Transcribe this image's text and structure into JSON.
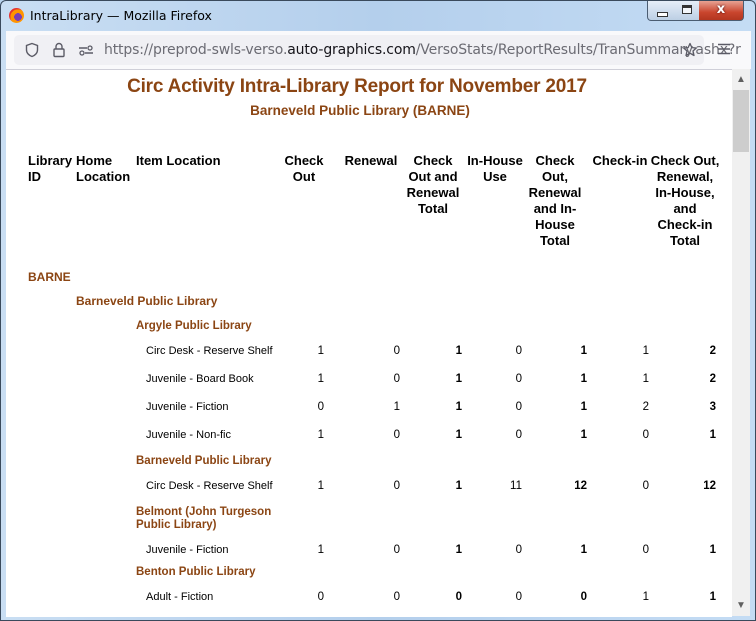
{
  "window": {
    "title": "IntraLibrary — Mozilla Firefox",
    "controls": {
      "minimize": "minimize",
      "maximize": "maximize",
      "close": "x"
    }
  },
  "browser": {
    "url_prefix": "https://preprod-swls-verso.",
    "url_domain": "auto-graphics.com",
    "url_path": "/VersoStats/ReportResults/TranSummary.ashx?r",
    "icons": [
      "shield-icon",
      "lock-icon",
      "permissions-icon",
      "bookmark-star-icon",
      "menu-icon"
    ]
  },
  "report": {
    "title": "Circ Activity Intra-Library Report for November 2017",
    "subtitle": "Barneveld Public Library (BARNE)",
    "columns": [
      "Library ID",
      "Home Location",
      "Item Location",
      "Check Out",
      "Renewal",
      "Check Out and Renewal Total",
      "In-House Use",
      "Check Out, Renewal and In-House Total",
      "Check-in",
      "Check Out, Renewal, In-House, and Check-in Total"
    ],
    "library_id": "BARNE",
    "home_location": "Barneveld Public Library",
    "groups": [
      {
        "name": "Argyle Public Library",
        "rows": [
          {
            "item": "Circ Desk - Reserve Shelf",
            "values": [
              "1",
              "0",
              "1",
              "0",
              "1",
              "1",
              "2"
            ]
          },
          {
            "item": "Juvenile - Board Book",
            "values": [
              "1",
              "0",
              "1",
              "0",
              "1",
              "1",
              "2"
            ]
          },
          {
            "item": "Juvenile - Fiction",
            "values": [
              "0",
              "1",
              "1",
              "0",
              "1",
              "2",
              "3"
            ]
          },
          {
            "item": "Juvenile - Non-fic",
            "values": [
              "1",
              "0",
              "1",
              "0",
              "1",
              "0",
              "1"
            ]
          }
        ]
      },
      {
        "name": "Barneveld Public Library",
        "rows": [
          {
            "item": "Circ Desk - Reserve Shelf",
            "values": [
              "1",
              "0",
              "1",
              "11",
              "12",
              "0",
              "12"
            ]
          }
        ]
      },
      {
        "name": "Belmont (John Turgeson Public Library)",
        "rows": [
          {
            "item": "Juvenile - Fiction",
            "values": [
              "1",
              "0",
              "1",
              "0",
              "1",
              "0",
              "1"
            ]
          }
        ]
      },
      {
        "name": "Benton Public Library",
        "rows": [
          {
            "item": "Adult - Fiction",
            "values": [
              "0",
              "0",
              "0",
              "0",
              "0",
              "1",
              "1"
            ]
          }
        ]
      }
    ]
  },
  "colors": {
    "accent": "#8b4513",
    "text": "#000000"
  }
}
